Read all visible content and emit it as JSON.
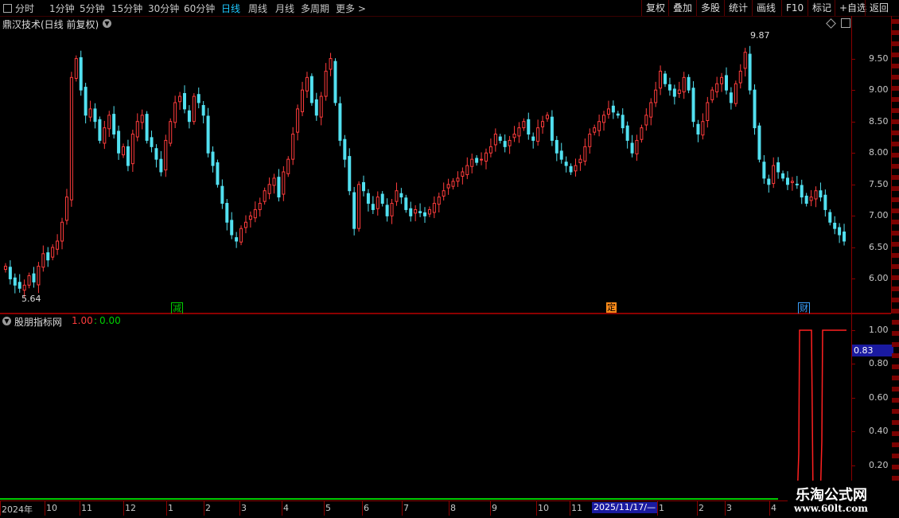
{
  "toolbar": {
    "periods": [
      "分时",
      "1分钟",
      "5分钟",
      "15分钟",
      "30分钟",
      "60分钟",
      "日线",
      "周线",
      "月线",
      "多周期",
      "更多 >"
    ],
    "active_period": "日线",
    "buttons": [
      "复权",
      "叠加",
      "多股",
      "统计",
      "画线",
      "F10",
      "标记",
      "+自选",
      "返回"
    ]
  },
  "main_chart": {
    "title": "鼎汉技术(日线 前复权)",
    "y_ticks": [
      "9.50",
      "9.00",
      "8.50",
      "8.00",
      "7.50",
      "7.00",
      "6.50",
      "6.00"
    ],
    "high_label": "9.87",
    "low_label": "5.64",
    "markers": [
      {
        "text": "减",
        "color": "#00d000"
      },
      {
        "text": "定",
        "color": "#ff8c1a"
      },
      {
        "text": "财",
        "color": "#3aa0ff"
      }
    ]
  },
  "indicator": {
    "name": "股朋指标网",
    "value1": "1.00",
    "value2": "0.00",
    "y_ticks": [
      "1.00",
      "0.80",
      "0.60",
      "0.40",
      "0.20"
    ],
    "current_value": "0.83"
  },
  "x_axis": {
    "labels": [
      "2024年",
      "10",
      "11",
      "12",
      "1",
      "2",
      "3",
      "4",
      "5",
      "6",
      "7",
      "8",
      "9",
      "10",
      "11",
      "1",
      "2",
      "3",
      "4"
    ],
    "cursor_date": "2025/11/17/—"
  },
  "watermark": {
    "line1": "乐淘公式网",
    "line2": "www.60lt.com"
  },
  "colors": {
    "up": "#ff3c3c",
    "down": "#52e0f0",
    "frame": "#8b0000",
    "indicator_line": "#ff2020",
    "bottom_bar": "#00c800"
  },
  "chart_data": {
    "type": "candlestick",
    "ylim": [
      5.5,
      9.95
    ],
    "closes": [
      6.2,
      6.0,
      5.9,
      5.85,
      5.9,
      6.05,
      5.95,
      6.2,
      6.4,
      6.3,
      6.5,
      6.6,
      6.9,
      7.3,
      9.2,
      9.5,
      9.0,
      8.6,
      8.7,
      8.5,
      8.2,
      8.4,
      8.6,
      8.3,
      8.0,
      8.1,
      7.8,
      8.3,
      8.5,
      8.6,
      8.2,
      8.1,
      7.9,
      7.7,
      8.2,
      8.5,
      8.8,
      8.9,
      8.7,
      8.5,
      8.9,
      8.8,
      8.6,
      8.0,
      7.8,
      7.5,
      7.2,
      6.9,
      6.7,
      6.6,
      6.8,
      6.9,
      7.0,
      7.1,
      7.2,
      7.4,
      7.5,
      7.6,
      7.3,
      7.7,
      7.9,
      8.3,
      8.7,
      9.0,
      9.2,
      8.8,
      8.6,
      8.9,
      9.3,
      9.5,
      8.8,
      8.2,
      7.9,
      7.4,
      6.8,
      7.5,
      7.4,
      7.2,
      7.1,
      7.3,
      7.2,
      7.0,
      7.2,
      7.4,
      7.3,
      7.1,
      7.0,
      7.1,
      7.05,
      7.0,
      7.1,
      7.2,
      7.3,
      7.4,
      7.5,
      7.55,
      7.6,
      7.7,
      7.8,
      7.9,
      7.85,
      7.9,
      8.0,
      8.1,
      8.3,
      8.2,
      8.1,
      8.2,
      8.3,
      8.4,
      8.5,
      8.3,
      8.2,
      8.4,
      8.5,
      8.6,
      8.2,
      8.0,
      7.9,
      7.8,
      7.7,
      7.8,
      7.9,
      8.1,
      8.3,
      8.4,
      8.5,
      8.6,
      8.7,
      8.65,
      8.6,
      8.4,
      8.2,
      8.0,
      8.2,
      8.4,
      8.6,
      8.8,
      9.0,
      9.3,
      9.1,
      9.0,
      8.9,
      9.0,
      9.2,
      9.0,
      8.5,
      8.3,
      8.5,
      8.8,
      9.0,
      9.1,
      9.2,
      9.0,
      8.8,
      9.1,
      9.3,
      9.6,
      9.0,
      8.4,
      7.9,
      7.6,
      7.5,
      7.8,
      7.7,
      7.6,
      7.5,
      7.55,
      7.5,
      7.3,
      7.2,
      7.3,
      7.4,
      7.3,
      7.1,
      6.9,
      6.8,
      6.7,
      6.6
    ]
  }
}
